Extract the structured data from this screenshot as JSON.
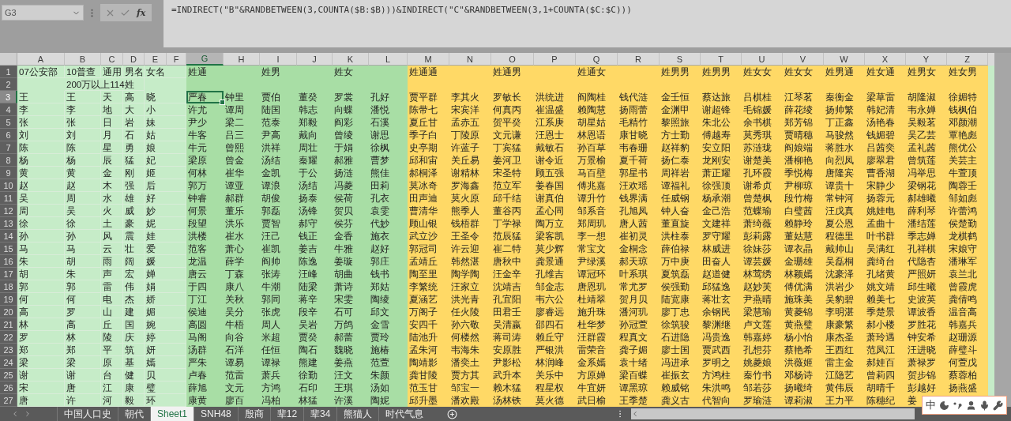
{
  "formula_bar": {
    "name_box": "G3",
    "function_label": "fx",
    "formula": "=INDIRECT(\"B\"&RANDBETWEEN(3,COUNTA($B:$B)))&INDIRECT(\"C\"&RANDBETWEEN(3,1+COUNTA($C:$C)))"
  },
  "columns": [
    {
      "label": "A",
      "selected": false,
      "color": "#c6ecc8"
    },
    {
      "label": "B",
      "selected": false,
      "color": "#c6ecc8"
    },
    {
      "label": "C",
      "selected": false,
      "color": "#c6ecc8"
    },
    {
      "label": "D",
      "selected": false,
      "color": "#c6ecc8"
    },
    {
      "label": "E",
      "selected": false,
      "color": "#c6ecc8"
    },
    {
      "label": "F",
      "selected": false,
      "color": "#c6ecc8"
    },
    {
      "label": "G",
      "selected": true,
      "color": "#a8dea5"
    },
    {
      "label": "H",
      "selected": false,
      "color": "#a8dea5"
    },
    {
      "label": "I",
      "selected": false,
      "color": "#a8dea5"
    },
    {
      "label": "J",
      "selected": false,
      "color": "#a8dea5"
    },
    {
      "label": "K",
      "selected": false,
      "color": "#a8dea5"
    },
    {
      "label": "L",
      "selected": false,
      "color": "#a8dea5"
    },
    {
      "label": "M",
      "selected": false,
      "color": "#ffd966"
    },
    {
      "label": "N",
      "selected": false,
      "color": "#ffd966"
    },
    {
      "label": "O",
      "selected": false,
      "color": "#ffd966"
    },
    {
      "label": "P",
      "selected": false,
      "color": "#ffd966"
    },
    {
      "label": "Q",
      "selected": false,
      "color": "#ffd966"
    },
    {
      "label": "R",
      "selected": false,
      "color": "#ffd966"
    },
    {
      "label": "S",
      "selected": false,
      "color": "#ffd966"
    },
    {
      "label": "T",
      "selected": false,
      "color": "#ffd966"
    },
    {
      "label": "U",
      "selected": false,
      "color": "#ffd966"
    },
    {
      "label": "V",
      "selected": false,
      "color": "#ffd966"
    },
    {
      "label": "W",
      "selected": false,
      "color": "#ffd966"
    },
    {
      "label": "X",
      "selected": false,
      "color": "#ffd966"
    },
    {
      "label": "Y",
      "selected": false,
      "color": "#ffd966"
    },
    {
      "label": "Z",
      "selected": false,
      "color": "#ffd966"
    }
  ],
  "rows": [
    {
      "number": "1",
      "selected": false,
      "cells": [
        "07公安部",
        "10普查",
        "通用",
        "男名",
        "女名",
        null,
        "姓通",
        null,
        "姓男",
        null,
        "姓女",
        null,
        "姓通通",
        null,
        "姓通男",
        null,
        "姓通女",
        null,
        "姓男男",
        "姓男男",
        "姓女女",
        "姓女女",
        "姓男通",
        "姓女通",
        "姓男女",
        "姓女男"
      ]
    },
    {
      "number": "2",
      "selected": false,
      "cells": [
        null,
        "200万以上114姓",
        null,
        null
      ]
    },
    {
      "number": "3",
      "selected": true,
      "cells": [
        "王",
        "王",
        "天",
        "高",
        "晓",
        null,
        "严春",
        "钟里",
        "贾伯",
        "董癸",
        "罗裳",
        "孔好",
        "贾平群",
        "李其火",
        "罗敏长",
        "洪统进",
        "阎陶桂",
        "钱代涟",
        "金壬恒",
        "蔡达旅",
        "吕棋桂",
        "江琴茗",
        "秦衡金",
        "梁草雷",
        "胡隆淑",
        "徐媚特"
      ]
    },
    {
      "number": "4",
      "selected": false,
      "cells": [
        "李",
        "李",
        "地",
        "大",
        "小",
        null,
        "许尤",
        "谭周",
        "陆国",
        "韩志",
        "向蝶",
        "潘悦",
        "陈带七",
        "宋宾洋",
        "何真丙",
        "崔温盛",
        "赖陶慧",
        "扬雨蕾",
        "金渊甲",
        "谢超锋",
        "毛锦媛",
        "薛花绫",
        "扬帅繁",
        "韩妃清",
        "韦永婵",
        "钱枫伯"
      ]
    },
    {
      "number": "5",
      "selected": false,
      "cells": [
        "张",
        "张",
        "日",
        "岩",
        "妹",
        null,
        "尹少",
        "梁二",
        "范泰",
        "郑毅",
        "阎彩",
        "石溪",
        "夏丘甘",
        "孟赤五",
        "贺平癸",
        "江系庚",
        "胡星姑",
        "毛精竹",
        "黎照旅",
        "朱北公",
        "余书棋",
        "郑芳锦",
        "丁正鑫",
        "汤艳春",
        "吴毅茗",
        "邓颜潮"
      ]
    },
    {
      "number": "6",
      "selected": false,
      "cells": [
        "刘",
        "刘",
        "月",
        "石",
        "姑",
        null,
        "牛客",
        "吕三",
        "尹高",
        "戴向",
        "曾绫",
        "谢思",
        "季子白",
        "丁陵原",
        "文元谦",
        "汪恩士",
        "林恩语",
        "康甘晓",
        "方士勤",
        "傅越寿",
        "莫秀琪",
        "贾晴穗",
        "马骏然",
        "钱媚碧",
        "吴乙芸",
        "覃艳彪"
      ]
    },
    {
      "number": "7",
      "selected": false,
      "cells": [
        "陈",
        "陈",
        "星",
        "勇",
        "娘",
        null,
        "牛元",
        "曾熙",
        "洪祥",
        "周壮",
        "于娟",
        "徐枫",
        "史亭期",
        "许蓝子",
        "丁宾猛",
        "戴敏石",
        "孙百草",
        "韦春珊",
        "赵祥豹",
        "安立阳",
        "苏涟珑",
        "阎娘端",
        "蒋胜水",
        "吕茜奕",
        "孟礼茜",
        "熊优公"
      ]
    },
    {
      "number": "8",
      "selected": false,
      "cells": [
        "杨",
        "杨",
        "辰",
        "猛",
        "妃",
        null,
        "梁原",
        "曾金",
        "汤结",
        "秦耀",
        "郝雅",
        "曹梦",
        "邱和宙",
        "关丘易",
        "姜河卫",
        "谢令近",
        "万景榆",
        "夏千荷",
        "扬仁泰",
        "龙刚安",
        "谢楚美",
        "潘柳艳",
        "向烈凤",
        "廖翠君",
        "曾筑莲",
        "关芸主"
      ]
    },
    {
      "number": "9",
      "selected": false,
      "cells": [
        "黄",
        "黄",
        "金",
        "刚",
        "姬",
        null,
        "何林",
        "崔华",
        "金凯",
        "于公",
        "扬涟",
        "熊佳",
        "郝桐泽",
        "谢精林",
        "宋圣特",
        "顾五强",
        "马百壁",
        "郭星书",
        "周祥岩",
        "萧正耀",
        "孔环霞",
        "季悦梅",
        "唐隆宾",
        "曹香湖",
        "冯举思",
        "牛萱顶"
      ]
    },
    {
      "number": "10",
      "selected": false,
      "cells": [
        "赵",
        "赵",
        "木",
        "强",
        "后",
        null,
        "郭万",
        "谭亚",
        "谭浪",
        "汤结",
        "冯菱",
        "田莉",
        "莫冰奇",
        "罗海鑫",
        "范立军",
        "姜春国",
        "傅兆嘉",
        "汪欢瑶",
        "谭福礼",
        "徐强顶",
        "谢希贞",
        "尹柳琼",
        "谭贵十",
        "宋静少",
        "梁钢花",
        "陶蓉壬"
      ]
    },
    {
      "number": "11",
      "selected": false,
      "cells": [
        "吴",
        "周",
        "水",
        "雄",
        "好",
        null,
        "钟睿",
        "郝群",
        "胡俊",
        "扬泰",
        "侯荷",
        "孔衣",
        "田声迪",
        "莫火原",
        "邱千结",
        "谢真伯",
        "谭升竹",
        "钱界满",
        "任威钢",
        "杨承潮",
        "曾楚枫",
        "段竹梅",
        "常钟河",
        "扬蓉元",
        "郝雄曦",
        "邹如彪"
      ]
    },
    {
      "number": "12",
      "selected": false,
      "cells": [
        "周",
        "吴",
        "火",
        "威",
        "妙",
        null,
        "何景",
        "董乐",
        "郭磊",
        "汤锋",
        "贺贝",
        "袁雯",
        "曹清华",
        "熊季人",
        "董谷丙",
        "孟心同",
        "邹系音",
        "孔旭凤",
        "钟人奋",
        "金己浩",
        "范蝶瑜",
        "白璧茜",
        "汪戊真",
        "姚娃电",
        "薛利琴",
        "许蕾鸿"
      ]
    },
    {
      "number": "13",
      "selected": false,
      "cells": [
        "徐",
        "徐",
        "土",
        "豪",
        "妮",
        null,
        "段望",
        "洪乐",
        "贾智",
        "郝守",
        "侯芬",
        "代妙",
        "顾山银",
        "钱梧群",
        "丁学禄",
        "陶万立",
        "郑周玑",
        "唐人茜",
        "董直旋",
        "文建祥",
        "萧绮薇",
        "赖静玲",
        "夏公恩",
        "孟曲十",
        "潘结莲",
        "侯楚勤"
      ]
    },
    {
      "number": "14",
      "selected": false,
      "cells": [
        "孙",
        "孙",
        "风",
        "震",
        "娃",
        null,
        "洪楼",
        "崔水",
        "汪己",
        "钱正",
        "金香",
        "施衣",
        "武立沙",
        "王圣令",
        "范辰猛",
        "梁客凯",
        "李一想",
        "崔初灵",
        "洪柱泰",
        "罗守耀",
        "彭莉露",
        "董姑慧",
        "程德里",
        "叶书群",
        "季志婵",
        "龙棋鹤"
      ]
    },
    {
      "number": "15",
      "selected": false,
      "cells": [
        "马",
        "马",
        "云",
        "壮",
        "爱",
        null,
        "范客",
        "萧心",
        "崔凯",
        "姜吉",
        "牛雅",
        "赵好",
        "郭冠司",
        "许云迎",
        "崔二特",
        "莫少辉",
        "常宝文",
        "金桐念",
        "薛伯禄",
        "林威进",
        "徐妹莎",
        "谭衣晶",
        "戴帅山",
        "吴满红",
        "孔祥棋",
        "宋娘守"
      ]
    },
    {
      "number": "16",
      "selected": false,
      "cells": [
        "朱",
        "胡",
        "雨",
        "阔",
        "媛",
        null,
        "龙温",
        "薛学",
        "阎帅",
        "陈逸",
        "姜璇",
        "郭庄",
        "孟靖丘",
        "韩然湛",
        "唐秋中",
        "龚景通",
        "尹绿溪",
        "郝天琼",
        "万中庚",
        "田奋人",
        "谭芸媛",
        "金珊雄",
        "吴磊桐",
        "龚绮台",
        "代隐杏",
        "潘琳军"
      ]
    },
    {
      "number": "17",
      "selected": false,
      "cells": [
        "胡",
        "朱",
        "声",
        "宏",
        "婵",
        null,
        "唐云",
        "丁森",
        "张涛",
        "汪峰",
        "胡曲",
        "钱书",
        "陶至里",
        "陶学陶",
        "汪金辛",
        "孔维吉",
        "谭冠环",
        "叶系琪",
        "夏筑磊",
        "赵道健",
        "林莺绣",
        "林颖嫣",
        "沈豪泽",
        "孔绪黄",
        "严照妍",
        "袁兰北"
      ]
    },
    {
      "number": "18",
      "selected": false,
      "cells": [
        "郭",
        "郭",
        "雷",
        "伟",
        "娟",
        null,
        "于四",
        "康八",
        "牛潮",
        "陆梁",
        "萧诗",
        "郑姑",
        "李繁统",
        "汪家立",
        "沈靖吉",
        "邹金志",
        "唐恩玑",
        "常尤罗",
        "侯强勤",
        "邱猛逸",
        "赵妙芙",
        "傅优满",
        "洪岩少",
        "姚文靖",
        "邱生曦",
        "曾霞虎"
      ]
    },
    {
      "number": "19",
      "selected": false,
      "cells": [
        "何",
        "何",
        "电",
        "杰",
        "娇",
        null,
        "丁江",
        "关秋",
        "郭同",
        "蒋辛",
        "宋雯",
        "陶绫",
        "夏涵艺",
        "洪光青",
        "孔宜阳",
        "韦六公",
        "杜靖翠",
        "贺月贝",
        "陆宽康",
        "蒋壮玄",
        "尹燕晴",
        "施珠美",
        "吴豹碧",
        "赖美七",
        "史波英",
        "龚倩鸣"
      ]
    },
    {
      "number": "20",
      "selected": false,
      "cells": [
        "高",
        "罗",
        "山",
        "建",
        "媚",
        null,
        "侯迪",
        "吴分",
        "张虎",
        "段辛",
        "石可",
        "邱文",
        "万阁子",
        "任火陵",
        "田君壬",
        "廖睿远",
        "施升珠",
        "潘河玑",
        "廖丁忠",
        "余钢民",
        "梁慧瑜",
        "黄菱锦",
        "李明湛",
        "季楚景",
        "谭波香",
        "温音高"
      ]
    },
    {
      "number": "21",
      "selected": false,
      "cells": [
        "林",
        "高",
        "丘",
        "国",
        "婉",
        null,
        "高圆",
        "牛梧",
        "周人",
        "吴岩",
        "万鸽",
        "金雪",
        "安四千",
        "孙六敬",
        "吴清嬴",
        "邵四石",
        "杜华梦",
        "孙冠萱",
        "徐筑骏",
        "黎渊继",
        "卢文莲",
        "黄燕璧",
        "康豪繁",
        "郝小楼",
        "罗胜花",
        "韩嘉兵"
      ]
    },
    {
      "number": "22",
      "selected": false,
      "cells": [
        "罗",
        "林",
        "陵",
        "庆",
        "婷",
        null,
        "马阁",
        "向谷",
        "米超",
        "贾癸",
        "郝蕾",
        "贾玲",
        "陆池升",
        "何楼然",
        "蒋司涛",
        "赖丘守",
        "汪群霞",
        "程真文",
        "石进隐",
        "冯贵逸",
        "韩嘉婷",
        "杨小怡",
        "康杰圣",
        "萧玲遇",
        "钟安希",
        "赵珊源"
      ]
    },
    {
      "number": "23",
      "selected": false,
      "cells": [
        "郑",
        "郑",
        "平",
        "筑",
        "妍",
        null,
        "汤群",
        "石洋",
        "任恒",
        "陶石",
        "魏晓",
        "施椿",
        "孟朱河",
        "韦海朱",
        "安原胜",
        "严银洪",
        "雷荣音",
        "龚子媚",
        "廖士国",
        "贾武西",
        "孔想芬",
        "蔡艳希",
        "王西红",
        "范凤江",
        "汪进晓",
        "薛璧斗"
      ]
    },
    {
      "number": "24",
      "selected": false,
      "cells": [
        "梁",
        "梁",
        "原",
        "基",
        "嫣",
        null,
        "严朱",
        "谭易",
        "谭禄",
        "熊建",
        "姜燕",
        "范萱",
        "陶靖影",
        "潘奕土",
        "尹影松",
        "林润峰",
        "金系嫣",
        "袁十绪",
        "冯进承",
        "罗明之",
        "姚菱娘",
        "洪薇姬",
        "雷主金",
        "郝娃百",
        "萧禄罗",
        "何萱戊"
      ]
    },
    {
      "number": "25",
      "selected": false,
      "cells": [
        "谢",
        "谢",
        "台",
        "健",
        "贝",
        null,
        "卢春",
        "范雷",
        "萧兵",
        "徐勤",
        "汪文",
        "朱颜",
        "龚甘陵",
        "贾方其",
        "武升本",
        "关乐中",
        "方原婵",
        "梁百蝶",
        "崔振玄",
        "方鸿柱",
        "秦竹书",
        "邓杨诗",
        "江隐艺",
        "曾莉四",
        "贺步锦",
        "蔡蓉柏"
      ]
    },
    {
      "number": "26",
      "selected": false,
      "cells": [
        "宋",
        "唐",
        "江",
        "康",
        "璧",
        null,
        "薛旭",
        "文元",
        "方鸿",
        "石印",
        "王琪",
        "汤如",
        "范玉甘",
        "邹宝一",
        "赖木猛",
        "程星权",
        "牛宜妍",
        "谭黑琼",
        "赖威铭",
        "朱洪鸣",
        "邹若莎",
        "扬曦绮",
        "黄伟辰",
        "胡晴千",
        "彭越好",
        "扬燕盛"
      ]
    },
    {
      "number": "27",
      "selected": false,
      "cells": [
        "唐",
        "许",
        "河",
        "毅",
        "环",
        null,
        "康黄",
        "廖百",
        "冯柏",
        "林猛",
        "许溪",
        "陶妮",
        "邱升墨",
        "潘欢殿",
        "汤林铁",
        "莫火德",
        "武日榆",
        "王季楚",
        "龚义古",
        "代智向",
        "罗瑜涟",
        "谭莉淑",
        "王力平",
        "陈穗纪",
        "姜"
      ]
    }
  ],
  "sheet_tabs": [
    {
      "label": "中国人口史",
      "selected": false
    },
    {
      "label": "朝代",
      "selected": false
    },
    {
      "label": "Sheet1",
      "selected": true
    },
    {
      "label": "SNH48",
      "selected": false
    },
    {
      "label": "殷商",
      "selected": false
    },
    {
      "label": "辈12",
      "selected": false
    },
    {
      "label": "辈34",
      "selected": false
    },
    {
      "label": "熊猫人",
      "selected": false
    },
    {
      "label": "时代气息",
      "selected": false
    }
  ],
  "ime_toolbar": {
    "mode": "中"
  }
}
